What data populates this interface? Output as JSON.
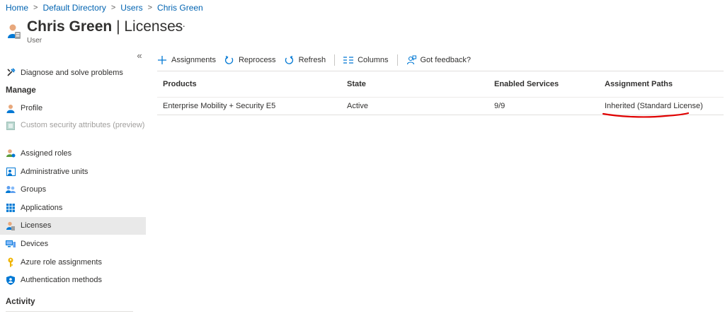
{
  "breadcrumb": {
    "items": [
      "Home",
      "Default Directory",
      "Users",
      "Chris Green"
    ],
    "separator": ">"
  },
  "header": {
    "name": "Chris Green",
    "pipe": "|",
    "section": "Licenses",
    "subtitle": "User",
    "more": "···"
  },
  "sidebar": {
    "collapse": "«",
    "diagnose": "Diagnose and solve problems",
    "manage_header": "Manage",
    "items": [
      {
        "label": "Profile",
        "icon": "profile-icon"
      },
      {
        "label": "Custom security attributes (preview)",
        "icon": "custom-attributes-icon",
        "disabled": true
      },
      {
        "label": "Assigned roles",
        "icon": "assigned-roles-icon"
      },
      {
        "label": "Administrative units",
        "icon": "admin-units-icon"
      },
      {
        "label": "Groups",
        "icon": "groups-icon"
      },
      {
        "label": "Applications",
        "icon": "applications-icon"
      },
      {
        "label": "Licenses",
        "icon": "licenses-icon",
        "active": true
      },
      {
        "label": "Devices",
        "icon": "devices-icon"
      },
      {
        "label": "Azure role assignments",
        "icon": "key-icon"
      },
      {
        "label": "Authentication methods",
        "icon": "shield-icon"
      }
    ],
    "activity_header": "Activity"
  },
  "toolbar": {
    "assignments": "Assignments",
    "reprocess": "Reprocess",
    "refresh": "Refresh",
    "columns": "Columns",
    "feedback": "Got feedback?"
  },
  "table": {
    "columns": [
      "Products",
      "State",
      "Enabled Services",
      "Assignment Paths"
    ],
    "rows": [
      {
        "product": "Enterprise Mobility + Security E5",
        "state": "Active",
        "enabled_services": "9/9",
        "assignment_paths": "Inherited (Standard License)"
      }
    ]
  },
  "colors": {
    "link": "#0063b1",
    "accent": "#0078d4",
    "annotation": "#e00000",
    "active_bg": "#e9e9e9"
  }
}
